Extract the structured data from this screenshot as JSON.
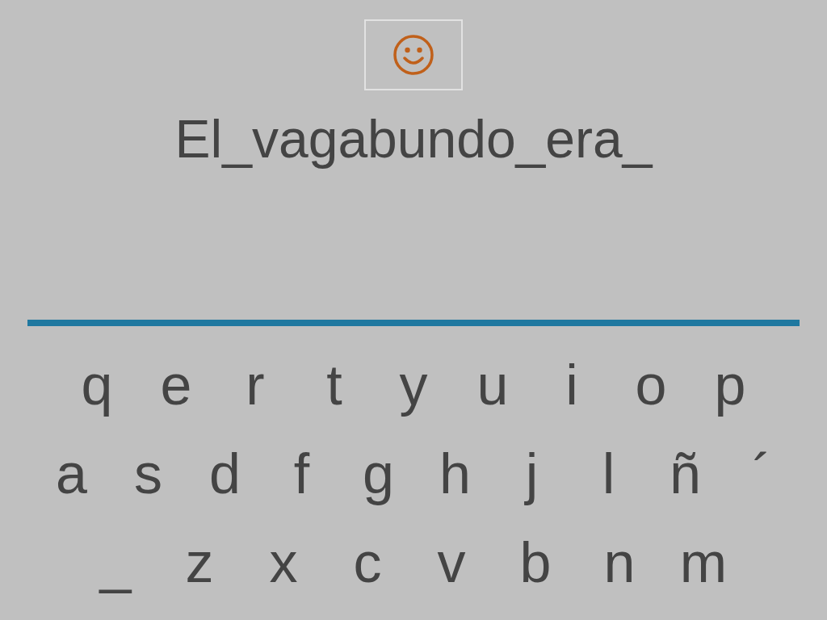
{
  "sentence": "El_vagabundo_era_",
  "keyboard": {
    "rows": [
      [
        "q",
        "e",
        "r",
        "t",
        "y",
        "u",
        "i",
        "o",
        "p"
      ],
      [
        "a",
        "s",
        "d",
        "f",
        "g",
        "h",
        "j",
        "l",
        "ñ",
        "´"
      ],
      [
        "_",
        "z",
        "x",
        "c",
        "v",
        "b",
        "n",
        "m"
      ]
    ]
  }
}
